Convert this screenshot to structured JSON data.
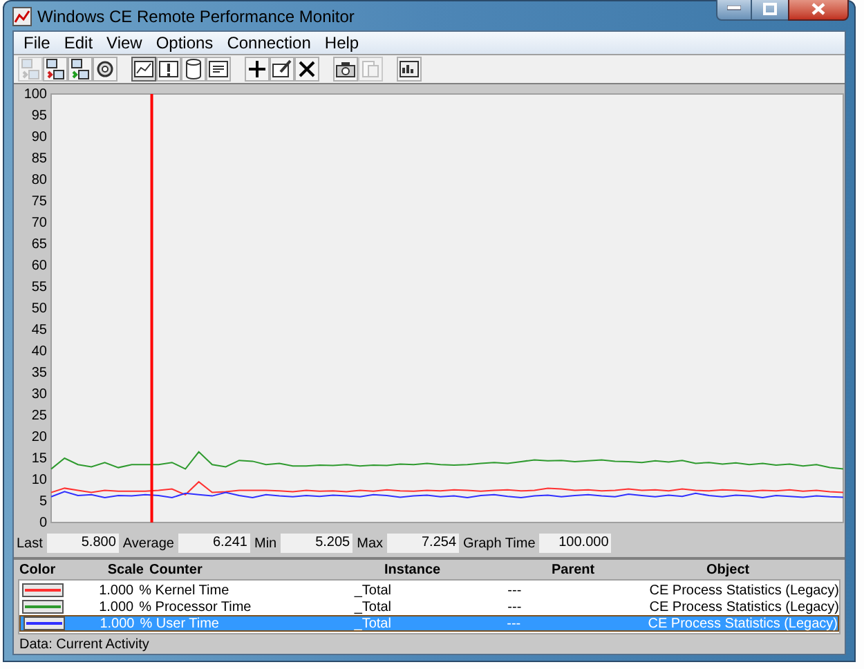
{
  "window": {
    "title": "Windows CE Remote Performance Monitor"
  },
  "menu": [
    "File",
    "Edit",
    "View",
    "Options",
    "Connection",
    "Help"
  ],
  "toolbar": [
    {
      "kind": "computer",
      "disabled": true
    },
    {
      "kind": "computer-red",
      "disabled": false
    },
    {
      "kind": "computer-green",
      "disabled": false
    },
    {
      "kind": "gear",
      "disabled": false
    },
    {
      "kind": "chart",
      "disabled": false,
      "gap": true,
      "pressed": true
    },
    {
      "kind": "alert",
      "disabled": false
    },
    {
      "kind": "cylinder",
      "disabled": false
    },
    {
      "kind": "report",
      "disabled": false
    },
    {
      "kind": "plus",
      "disabled": false,
      "gap": true
    },
    {
      "kind": "edit",
      "disabled": false
    },
    {
      "kind": "delete",
      "disabled": false
    },
    {
      "kind": "camera",
      "disabled": false,
      "gap": true
    },
    {
      "kind": "page",
      "disabled": true
    },
    {
      "kind": "options",
      "disabled": false,
      "gap": true
    }
  ],
  "graph": {
    "cursor": {
      "level": 0.127
    },
    "chart_data": {
      "type": "line",
      "ylim": [
        0,
        100
      ],
      "yticks": [
        0,
        5,
        10,
        15,
        20,
        25,
        30,
        35,
        40,
        45,
        50,
        55,
        60,
        65,
        70,
        75,
        80,
        85,
        90,
        95,
        100
      ],
      "series": [
        {
          "color": "#ff3030",
          "values": [
            7,
            8,
            7.5,
            7,
            7.5,
            7.3,
            7.3,
            7.3,
            7.5,
            7.8,
            6.5,
            9.5,
            7,
            7.2,
            7.5,
            7.5,
            7.5,
            7.4,
            7.2,
            7.5,
            7.3,
            7.4,
            7.2,
            7.5,
            7.3,
            7.6,
            7.4,
            7.3,
            7.5,
            7.4,
            7.6,
            7.5,
            7.3,
            7.5,
            7.6,
            7.4,
            7.5,
            8,
            7.8,
            7.5,
            7.6,
            7.4,
            7.5,
            7.8,
            7.5,
            7.6,
            7.4,
            7.8,
            7.5,
            7.4,
            7.6,
            7.5,
            7.3,
            7.5,
            7.4,
            7.6,
            7.3,
            7.5,
            7.2,
            7
          ]
        },
        {
          "color": "#2e9a2e",
          "values": [
            12.5,
            15,
            13.5,
            13,
            14,
            12.8,
            13.5,
            13.5,
            13.5,
            14,
            12.5,
            16.5,
            13.5,
            13,
            14.5,
            14.3,
            13.5,
            13.8,
            13.2,
            13.2,
            13.4,
            13.3,
            13.5,
            13.2,
            13.4,
            13.3,
            13.6,
            13.5,
            13.8,
            13.5,
            13.4,
            13.5,
            13.8,
            14,
            13.8,
            14.2,
            14.6,
            14.4,
            14.5,
            14.2,
            14.4,
            14.6,
            14.3,
            14.2,
            14,
            14.4,
            14.1,
            14.5,
            13.8,
            14,
            13.6,
            13.9,
            13.5,
            13.8,
            13.4,
            13.6,
            13.2,
            13.5,
            12.8,
            12.5
          ]
        },
        {
          "color": "#3030ff",
          "values": [
            6,
            7.2,
            6.3,
            6.5,
            5.8,
            6.3,
            6.2,
            6.5,
            6.3,
            5.8,
            6.8,
            6.5,
            6.2,
            7,
            6.3,
            5.8,
            6.5,
            6.2,
            6,
            6.3,
            6.1,
            6.4,
            6.2,
            6,
            6.5,
            6.3,
            5.9,
            6.2,
            6.4,
            6,
            6.2,
            5.8,
            6.3,
            6.5,
            6.1,
            5.8,
            6.2,
            6.4,
            6,
            6.3,
            6.5,
            6.2,
            6,
            6.6,
            6.3,
            6,
            6.4,
            6.1,
            6.8,
            6.3,
            6,
            6.4,
            6.2,
            5.8,
            6.3,
            6.1,
            5.9,
            6.2,
            6,
            5.9
          ]
        }
      ]
    }
  },
  "stats": [
    {
      "label": "Last",
      "value": "5.800"
    },
    {
      "label": "Average",
      "value": "6.241"
    },
    {
      "label": "Min",
      "value": "5.205"
    },
    {
      "label": "Max",
      "value": "7.254"
    },
    {
      "label": "Graph Time",
      "value": "100.000"
    }
  ],
  "table": {
    "columns": [
      "Color",
      "Scale",
      "Counter",
      "Instance",
      "Parent",
      "Object"
    ],
    "rows": [
      {
        "color": "#ff3030",
        "scale": "1.000",
        "counter": "% Kernel Time",
        "instance": "_Total",
        "parent": "---",
        "object": "CE Process Statistics (Legacy)",
        "selected": false
      },
      {
        "color": "#2e9a2e",
        "scale": "1.000",
        "counter": "% Processor Time",
        "instance": "_Total",
        "parent": "---",
        "object": "CE Process Statistics (Legacy)",
        "selected": false
      },
      {
        "color": "#3030ff",
        "scale": "1.000",
        "counter": "% User Time",
        "instance": "_Total",
        "parent": "---",
        "object": "CE Process Statistics (Legacy)",
        "selected": true
      }
    ]
  },
  "status_bar": "Data: Current Activity"
}
